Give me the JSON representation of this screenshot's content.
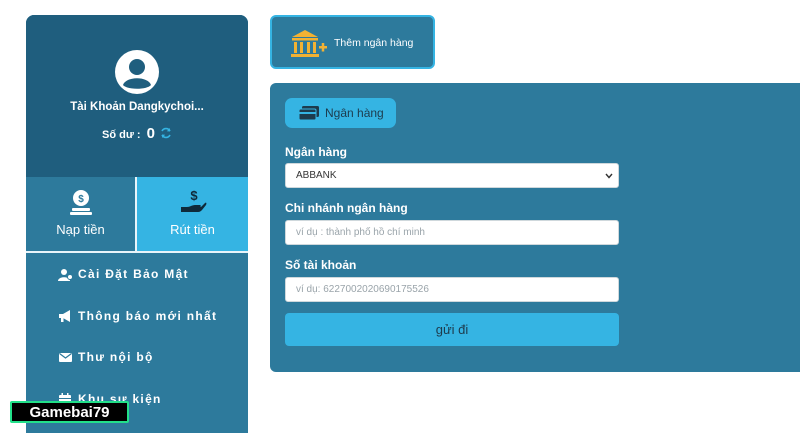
{
  "account": {
    "username": "Tài Khoản Dangkychoi...",
    "balance_label": "Số dư :",
    "balance_value": "0"
  },
  "actions": {
    "deposit": "Nạp tiền",
    "withdraw": "Rút tiền"
  },
  "menu": {
    "items": [
      {
        "label": "Cài Đặt Bảo Mật",
        "icon": "user-gear-icon"
      },
      {
        "label": "Thông báo mới nhất",
        "icon": "megaphone-icon"
      },
      {
        "label": "Thư nội bộ",
        "icon": "envelope-icon"
      },
      {
        "label": "Khu sự kiện",
        "icon": "calendar-icon"
      }
    ]
  },
  "add_bank": {
    "label": "Thêm ngân hàng",
    "icon": "bank-plus-icon"
  },
  "bank_form": {
    "tab_label": "Ngân hàng",
    "bank_label": "Ngân hàng",
    "bank_selected": "ABBANK",
    "branch_label": "Chi nhánh ngân hàng",
    "branch_placeholder": "ví dụ : thành phố hồ chí minh",
    "account_label": "Số tài khoản",
    "account_placeholder": "ví dụ:  6227002020690175526",
    "submit_label": "gửi đi"
  },
  "watermark": "Gamebai79",
  "colors": {
    "panel": "#2d7a9c",
    "profile": "#1f5e7e",
    "accent": "#35b4e3",
    "bank_icon": "#f2b233"
  }
}
